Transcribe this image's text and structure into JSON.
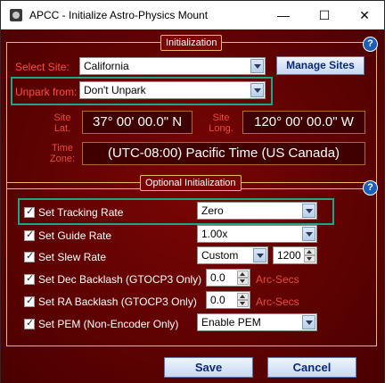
{
  "window": {
    "title": "APCC - Initialize Astro-Physics Mount",
    "minimize_glyph": "—",
    "maximize_glyph": "☐",
    "close_glyph": "✕"
  },
  "colors": {
    "background": "#6b0000",
    "group_border": "#e8b86a",
    "label_red": "#ff4c3a",
    "highlight": "#1aa58c",
    "button_text": "#0a2a78"
  },
  "initialization": {
    "title": "Initialization",
    "help_glyph": "?",
    "select_site": {
      "label": "Select Site:",
      "value": "California"
    },
    "manage_sites_button": "Manage Sites",
    "unpark_from": {
      "label": "Unpark from:",
      "value": "Don't Unpark"
    },
    "site_lat": {
      "label_line1": "Site",
      "label_line2": "Lat.",
      "value": "37° 00' 00.0\" N"
    },
    "site_long": {
      "label_line1": "Site",
      "label_line2": "Long.",
      "value": "120° 00' 00.0\" W"
    },
    "time_zone": {
      "label_line1": "Time",
      "label_line2": "Zone:",
      "value": "(UTC-08:00) Pacific Time (US  Canada)"
    }
  },
  "optional": {
    "title": "Optional Initialization",
    "help_glyph": "?",
    "tracking_rate": {
      "label": "Set Tracking Rate",
      "value": "Zero",
      "checked": true
    },
    "guide_rate": {
      "label": "Set Guide Rate",
      "value": "1.00x",
      "checked": true
    },
    "slew_rate": {
      "label": "Set Slew Rate",
      "value": "Custom",
      "custom_value": "1200",
      "checked": true
    },
    "dec_backlash": {
      "label": "Set Dec Backlash (GTOCP3 Only)",
      "value": "0.0",
      "units": "Arc-Secs",
      "checked": true
    },
    "ra_backlash": {
      "label": "Set RA Backlash (GTOCP3 Only)",
      "value": "0.0",
      "units": "Arc-Secs",
      "checked": true
    },
    "pem": {
      "label": "Set PEM (Non-Encoder Only)",
      "value": "Enable PEM",
      "checked": true
    }
  },
  "footer": {
    "save_label": "Save",
    "cancel_label": "Cancel"
  },
  "icons": {
    "app": "telescope-app-icon",
    "help": "help-icon",
    "dropdown": "chevron-down-icon",
    "checkbox": "checkmark-icon"
  }
}
